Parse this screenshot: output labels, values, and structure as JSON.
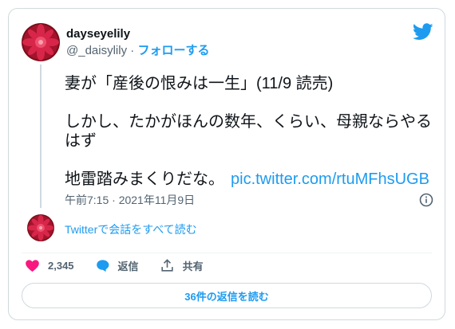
{
  "user": {
    "display_name": "dayseyelily",
    "handle": "@_daisylily",
    "separator": "·",
    "follow_label": "フォローする"
  },
  "tweet": {
    "line1": "妻が「産後の恨みは一生」(11/9 読売)",
    "line2": "しかし、たかがほんの数年、くらい、母親ならやるはず",
    "line3": "地雷踏みまくりだな。",
    "link": "pic.twitter.com/rtuMFhsUGB",
    "timestamp": "午前7:15 · 2021年11月9日"
  },
  "conversation_link": "Twitterで会話をすべて読む",
  "actions": {
    "like_count": "2,345",
    "reply_label": "返信",
    "share_label": "共有"
  },
  "read_replies_button": "36件の返信を読む",
  "colors": {
    "accent": "#1d9bf0",
    "like": "#f91880",
    "text": "#0f1419",
    "muted": "#536471"
  }
}
